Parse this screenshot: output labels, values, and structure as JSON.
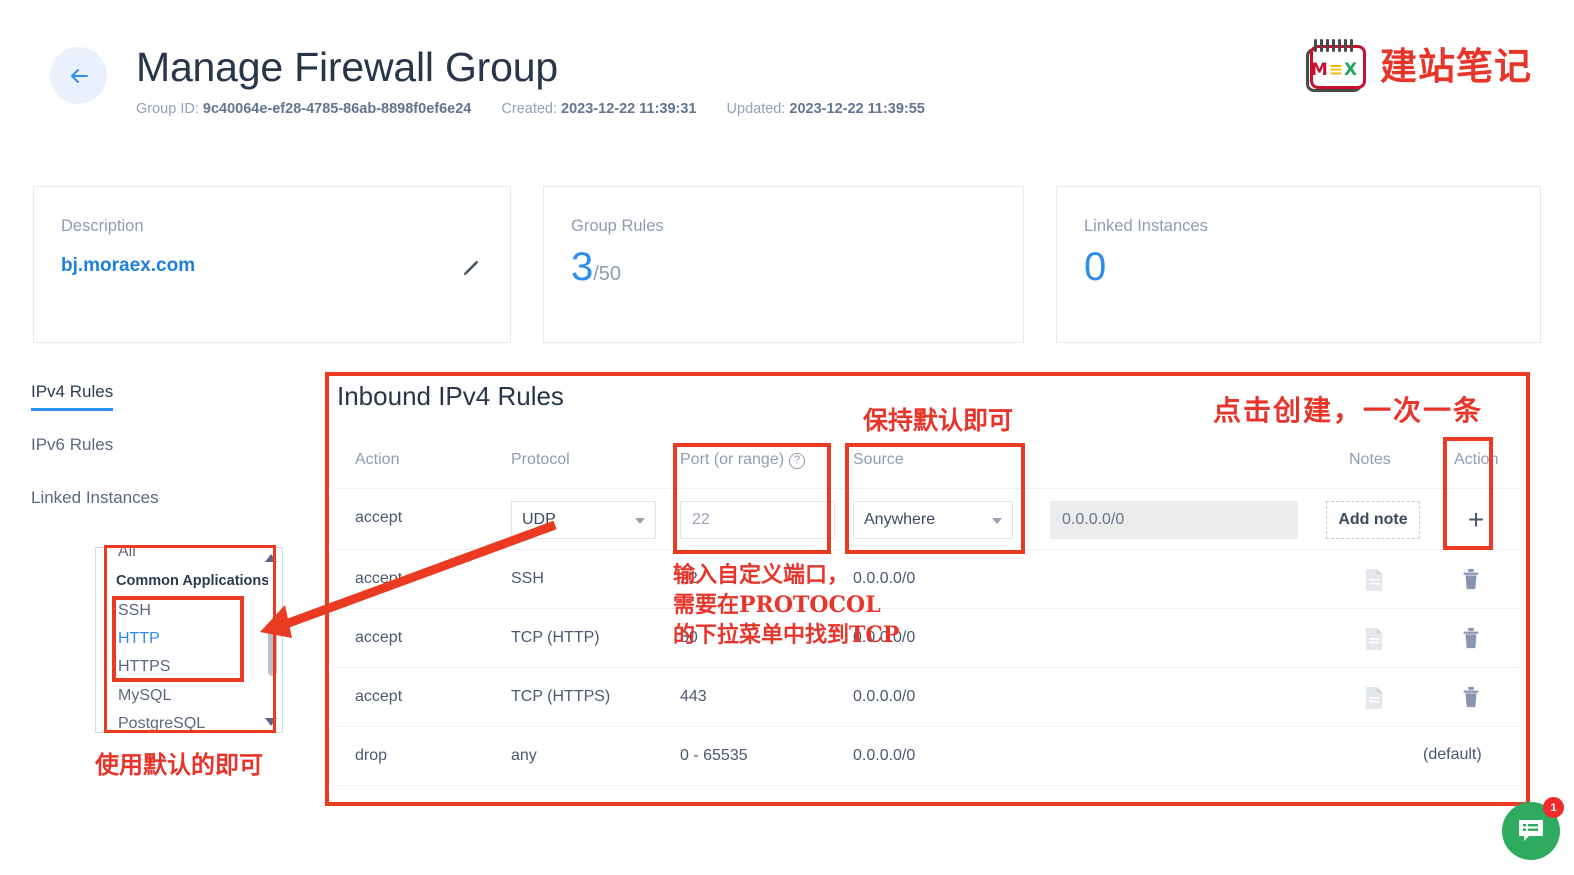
{
  "header": {
    "title": "Manage Firewall Group",
    "back_icon": "arrow-left-icon",
    "meta": [
      {
        "label": "Group ID:",
        "value": "9c40064e-ef28-4785-86ab-8898f0ef6e24"
      },
      {
        "label": "Created:",
        "value": "2023-12-22 11:39:31"
      },
      {
        "label": "Updated:",
        "value": "2023-12-22 11:39:55"
      }
    ],
    "logo": {
      "m": "M",
      "e": "≡",
      "x": "X",
      "brand_cn": "建站笔记"
    }
  },
  "cards": {
    "description": {
      "label": "Description",
      "value": "bj.moraex.com",
      "edit_icon": "pencil-icon"
    },
    "group_rules": {
      "label": "Group Rules",
      "count": "3",
      "limit": "/50"
    },
    "linked_instances": {
      "label": "Linked Instances",
      "count": "0"
    }
  },
  "sidebar": {
    "items": [
      {
        "label": "IPv4 Rules",
        "active": true
      },
      {
        "label": "IPv6 Rules",
        "active": false
      },
      {
        "label": "Linked Instances",
        "active": false
      }
    ]
  },
  "protocol_dropdown": {
    "cut_item": "All",
    "group_header": "Common Applications",
    "options": [
      {
        "label": "SSH",
        "selected": false
      },
      {
        "label": "HTTP",
        "selected": true
      },
      {
        "label": "HTTPS",
        "selected": false
      },
      {
        "label": "MySQL",
        "selected": false
      },
      {
        "label": "PostgreSQL",
        "selected": false
      }
    ]
  },
  "rules": {
    "title": "Inbound IPv4 Rules",
    "columns": {
      "action": "Action",
      "protocol": "Protocol",
      "port": "Port (or range)",
      "port_help_icon": "question-mark-icon",
      "source": "Source",
      "notes": "Notes",
      "action_col": "Action"
    },
    "new_row": {
      "action": "accept",
      "protocol_value": "UDP",
      "port_placeholder": "22",
      "source_value": "Anywhere",
      "cidr_value": "0.0.0.0/0",
      "add_note_label": "Add note",
      "add_button": "+"
    },
    "rows": [
      {
        "action": "accept",
        "protocol": "SSH",
        "port": "22",
        "source": "0.0.0.0/0",
        "note_icon": "document-icon",
        "delete_icon": "trash-icon"
      },
      {
        "action": "accept",
        "protocol": "TCP (HTTP)",
        "port": "80",
        "source": "0.0.0.0/0",
        "note_icon": "document-icon",
        "delete_icon": "trash-icon"
      },
      {
        "action": "accept",
        "protocol": "TCP (HTTPS)",
        "port": "443",
        "source": "0.0.0.0/0",
        "note_icon": "document-icon",
        "delete_icon": "trash-icon"
      },
      {
        "action": "drop",
        "protocol": "any",
        "port": "0 - 65535",
        "source": "0.0.0.0/0",
        "note_icon": "",
        "delete_icon": "",
        "default_label": "(default)"
      }
    ]
  },
  "annotations": {
    "keep_default": "保持默认即可",
    "click_create": "点击创建，一次一条",
    "custom_port_1": "输入自定义端口，",
    "custom_port_2": "需要在PROTOCOL",
    "custom_port_3": "的下拉菜单中找到TCP",
    "use_default": "使用默认的即可",
    "color": "#e8352b"
  },
  "chat": {
    "icon": "chat-list-icon",
    "badge": "1"
  }
}
